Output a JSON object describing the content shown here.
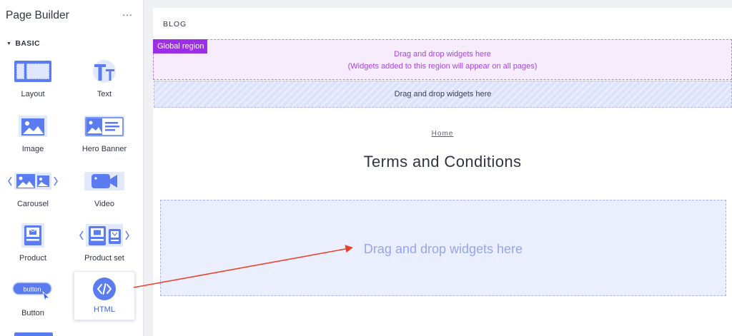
{
  "sidebar": {
    "title": "Page Builder",
    "more": "···",
    "section": {
      "caret": "▼",
      "label": "BASIC"
    },
    "widgets": [
      {
        "label": "Layout"
      },
      {
        "label": "Text"
      },
      {
        "label": "Image"
      },
      {
        "label": "Hero Banner"
      },
      {
        "label": "Carousel"
      },
      {
        "label": "Video"
      },
      {
        "label": "Product"
      },
      {
        "label": "Product set"
      },
      {
        "label": "Button",
        "icon_text": "button"
      },
      {
        "label": "HTML"
      }
    ]
  },
  "canvas": {
    "header": "BLOG",
    "global_region": {
      "tag": "Global region",
      "line1": "Drag and drop widgets here",
      "line2": "(Widgets added to this region will appear on all pages)"
    },
    "region2": "Drag and drop widgets here",
    "breadcrumb": "Home",
    "page_title": "Terms and Conditions",
    "drop_zone": "Drag and drop widgets here"
  },
  "colors": {
    "accent": "#3c64f4",
    "icon": "#5b7cf0",
    "global": "#9b2ee6",
    "arrow": "#e8432e"
  }
}
